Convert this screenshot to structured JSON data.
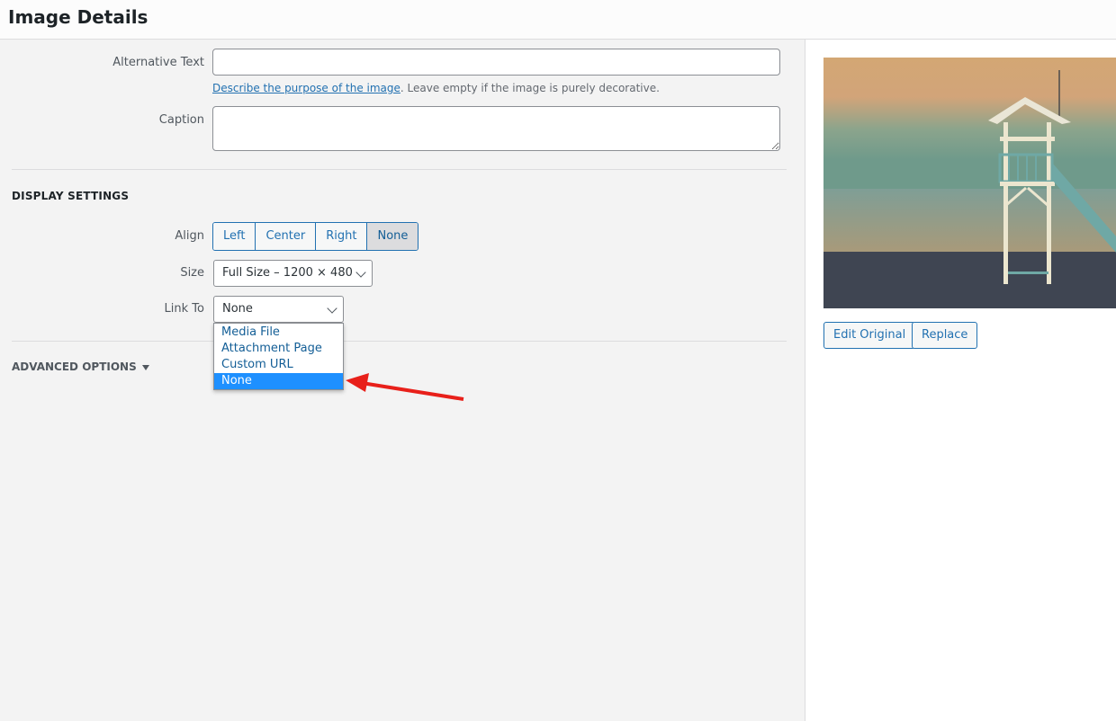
{
  "header": {
    "title": "Image Details"
  },
  "form": {
    "alt_text": {
      "label": "Alternative Text",
      "value": "",
      "placeholder": ""
    },
    "alt_help": {
      "link": "Describe the purpose of the image",
      "text": ". Leave empty if the image is purely decorative."
    },
    "caption": {
      "label": "Caption",
      "value": ""
    }
  },
  "display_settings": {
    "title": "DISPLAY SETTINGS",
    "align": {
      "label": "Align",
      "options": [
        "Left",
        "Center",
        "Right",
        "None"
      ],
      "selected": "None"
    },
    "size": {
      "label": "Size",
      "value": "Full Size – 1200 × 480"
    },
    "link_to": {
      "label": "Link To",
      "value": "None",
      "options": [
        "Media File",
        "Attachment Page",
        "Custom URL",
        "None"
      ],
      "highlighted": "None"
    }
  },
  "advanced": {
    "label": "ADVANCED OPTIONS"
  },
  "sidebar": {
    "image_alt": "Lifeguard tower on beach at dusk",
    "edit_original": "Edit Original",
    "replace": "Replace"
  },
  "annotation": {
    "arrow_color": "#e8201a"
  },
  "colors": {
    "accent": "#2271b1",
    "highlight": "#1e90ff"
  }
}
